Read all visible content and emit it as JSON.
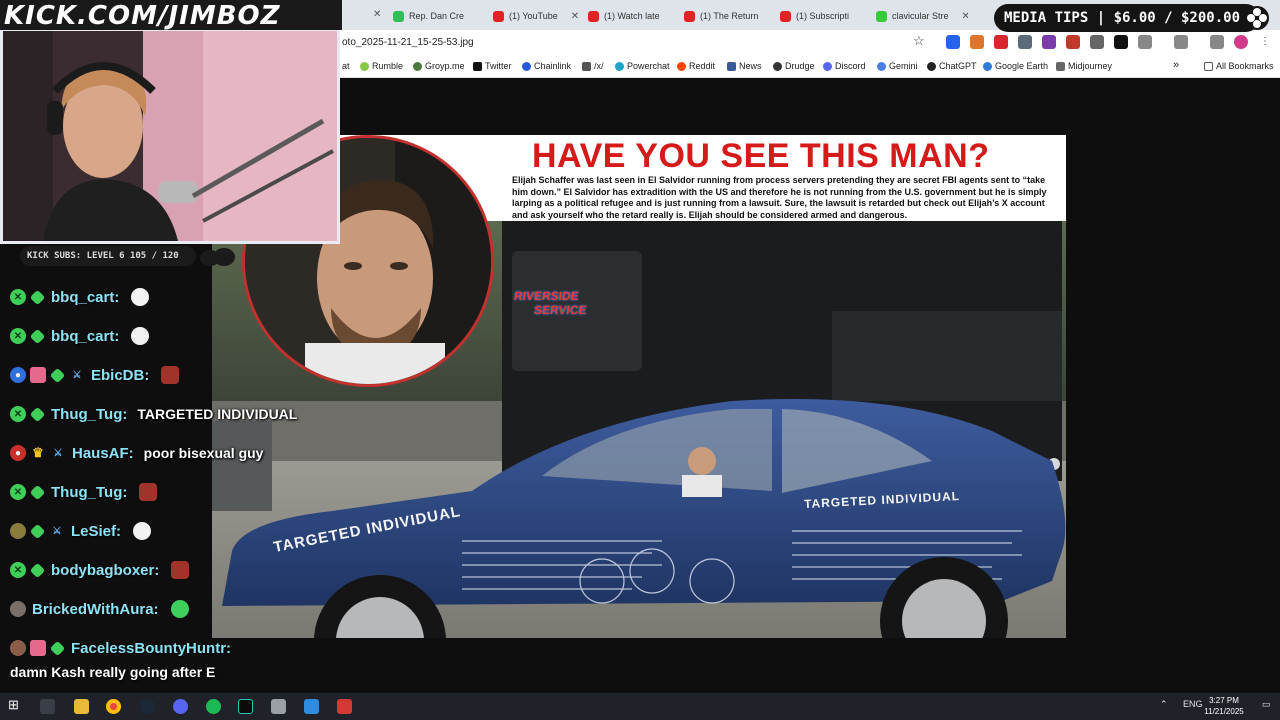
{
  "overlay": {
    "logo": "KICK.COM/JIMBOZ",
    "media_tips": "MEDIA TIPS | $6.00 / $200.00",
    "kick_subs": "KICK SUBS: LEVEL 6 105 / 120"
  },
  "browser": {
    "tabs": [
      {
        "label": "Rep. Dan Cre",
        "color": "#2fbf55"
      },
      {
        "label": "(1) YouTube",
        "color": "#e02424"
      },
      {
        "label": "(1) Watch late",
        "color": "#e02424"
      },
      {
        "label": "(1) The Return",
        "color": "#e02424"
      },
      {
        "label": "(1) Subscripti",
        "color": "#e02424"
      },
      {
        "label": "clavicular Stre",
        "color": "#39c93d"
      }
    ],
    "address": "oto_2025-11-21_15-25-53.jpg",
    "bookmarks": [
      {
        "label": "at"
      },
      {
        "label": "Rumble"
      },
      {
        "label": "Groyp.me"
      },
      {
        "label": "Twitter"
      },
      {
        "label": "Chainlink"
      },
      {
        "label": "/x/"
      },
      {
        "label": "Powerchat"
      },
      {
        "label": "Reddit"
      },
      {
        "label": "News"
      },
      {
        "label": "Drudge"
      },
      {
        "label": "Discord"
      },
      {
        "label": "Gemini"
      },
      {
        "label": "ChatGPT"
      },
      {
        "label": "Google Earth"
      },
      {
        "label": "Midjourney"
      }
    ],
    "more": "»",
    "all_bookmarks": "All Bookmarks"
  },
  "poster": {
    "title": "HAVE YOU SEE THIS MAN?",
    "body": "Elijah Schaffer was last seen in El Salvidor running from process servers pretending they are secret FBI agents sent to “take him down.” El Salvidor has extradition with the US and therefore he is not running from the U.S. government but he is simply larping as a political refugee and is just running from a lawsuit. Sure, the lawsuit is retarded but check out Elijah’s X account and ask yourself who the retard really is. Elijah should be considered armed and dangerous.",
    "car_text_front": "TARGETED INDIVIDUAL",
    "car_text_rear": "TARGETED INDIVIDUAL",
    "truck_text_1": "RIVERSIDE",
    "truck_text_2": "SERVICE"
  },
  "chat": [
    {
      "user": "bbq_cart:",
      "text": "",
      "badges": [
        "x-green",
        "diamond"
      ],
      "emote": "#f2f2f2"
    },
    {
      "user": "bbq_cart:",
      "text": "",
      "badges": [
        "x-green",
        "diamond"
      ],
      "emote": "#f2f2f2"
    },
    {
      "user": "EbicDB:",
      "text": "",
      "badges": [
        "blue-circle",
        "gift",
        "diamond",
        "sword"
      ],
      "emote": "#a0342a"
    },
    {
      "user": "Thug_Tug:",
      "text": "TARGETED INDIVIDUAL",
      "badges": [
        "x-green",
        "diamond"
      ],
      "emote": ""
    },
    {
      "user": "HausAF:",
      "text": "poor bisexual guy",
      "badges": [
        "red-circle",
        "crown",
        "sword"
      ],
      "emote": ""
    },
    {
      "user": "Thug_Tug:",
      "text": "",
      "badges": [
        "x-green",
        "diamond"
      ],
      "emote": "#a0342a"
    },
    {
      "user": "LeSief:",
      "text": "",
      "badges": [
        "avatar",
        "diamond",
        "sword"
      ],
      "emote": "#f2f2f2"
    },
    {
      "user": "bodybagboxer:",
      "text": "",
      "badges": [
        "x-green",
        "diamond"
      ],
      "emote": "#a0342a"
    },
    {
      "user": "BrickedWithAura:",
      "text": "",
      "badges": [
        "avatar2"
      ],
      "emote": "#3ecf5c"
    },
    {
      "user": "FacelessBountyHuntr:",
      "text": "",
      "badges": [
        "avatar3",
        "gift",
        "diamond"
      ],
      "emote": ""
    }
  ],
  "chat_last_line": "damn Kash really going after E",
  "taskbar": {
    "lang": "ENG",
    "time": "3:27 PM",
    "date": "11/21/2025"
  }
}
